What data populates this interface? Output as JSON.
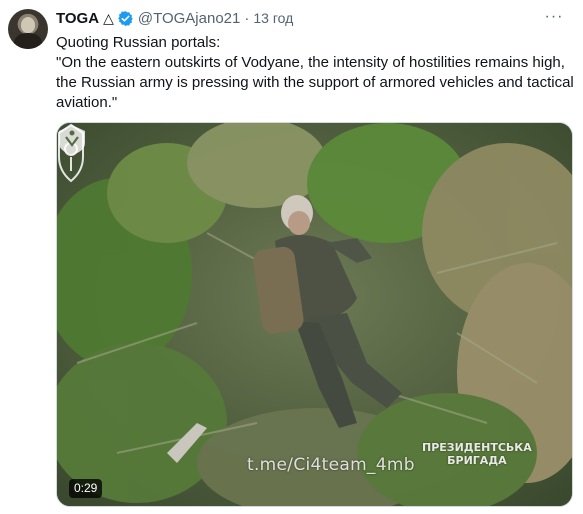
{
  "author": {
    "name": "TOGA",
    "symbol": "△",
    "handle": "@TOGAjano21",
    "time": "13 год",
    "verified_color": "#1d9bf0"
  },
  "tweet": {
    "line1": "Quoting Russian portals:",
    "quote": "\"On the eastern outskirts of Vodyane, the intensity of hostilities remains high, the Russian army is pressing with the support of armored vehicles and tactical aviation.\""
  },
  "media": {
    "watermark_url": "t.me/Ci4team_4mb",
    "brigade_line1": "ПРЕЗИДЕНТСЬКА",
    "brigade_line2": "БРИГАДА",
    "duration": "0:29"
  },
  "menu": {
    "more_glyph": "···"
  },
  "colors": {
    "text": "#0f1419",
    "secondary": "#536471",
    "border": "#cfd9de"
  }
}
